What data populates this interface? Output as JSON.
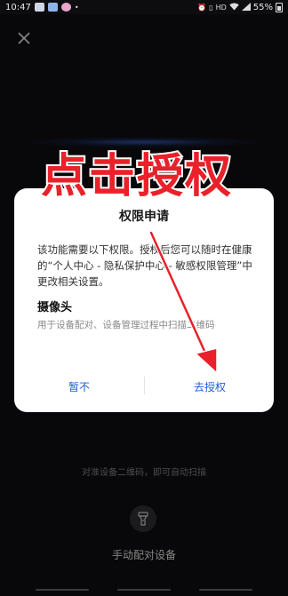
{
  "status_bar": {
    "time": "10:47",
    "hd": "HD",
    "battery": "55%"
  },
  "scan": {
    "hint": "对准设备二维码，即可自动扫描",
    "manual_pair": "手动配对设备"
  },
  "dialog": {
    "title": "权限申请",
    "description": "该功能需要以下权限。授权后您可以随时在健康的“个人中心 - 隐私保护中心 - 敏感权限管理”中更改相关设置。",
    "permission_name": "摄像头",
    "permission_desc": "用于设备配对、设备管理过程中扫描二维码",
    "deny_label": "暂不",
    "allow_label": "去授权"
  },
  "annotation": {
    "text": "点击授权"
  },
  "colors": {
    "accent": "#1d5ed9",
    "annotation": "#e8212a",
    "scan_glow": "#3c78ff"
  }
}
